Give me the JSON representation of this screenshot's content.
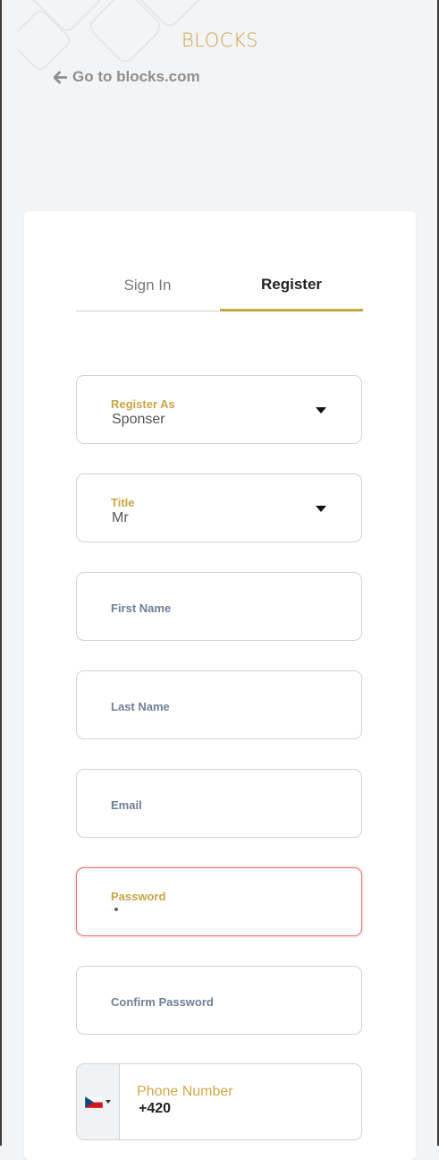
{
  "brand": {
    "logo_text": "BLOCKS",
    "accent_color": "#c9a548"
  },
  "header": {
    "back_link_text": "Go to blocks.com"
  },
  "tabs": [
    {
      "label": "Sign In",
      "active": false
    },
    {
      "label": "Register",
      "active": true
    }
  ],
  "form": {
    "register_as": {
      "label": "Register As",
      "value": "Sponser"
    },
    "title": {
      "label": "Title",
      "value": "Mr"
    },
    "first_name": {
      "label": "First Name"
    },
    "last_name": {
      "label": "Last Name"
    },
    "email": {
      "label": "Email"
    },
    "password": {
      "label": "Password",
      "value": "•",
      "state": "error",
      "error_color": "#e57373"
    },
    "confirm_password": {
      "label": "Confirm Password"
    },
    "phone": {
      "label": "Phone Number",
      "value": "+420",
      "country_flag": "czech-republic-flag"
    }
  }
}
